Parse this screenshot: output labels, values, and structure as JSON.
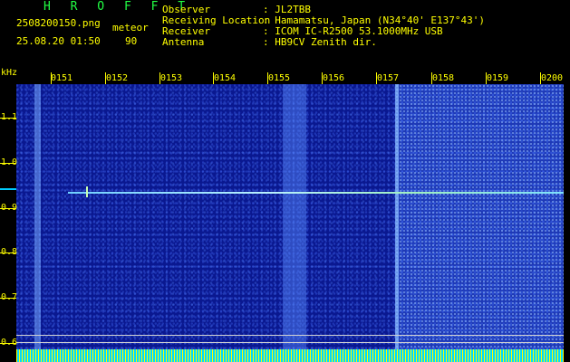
{
  "header": {
    "brand": "H R O F F T",
    "filename": "2508200150.png",
    "datetime": "25.08.20 01:50",
    "meteor_label": "meteor",
    "meteor_count": "90"
  },
  "info": [
    {
      "key": "Observer",
      "value": ": JL2TBB"
    },
    {
      "key": "Receiving Location",
      "value": ": Hamamatsu, Japan (N34°40' E137°43')"
    },
    {
      "key": "Receiver",
      "value": ": ICOM IC-R2500 53.1000MHz USB"
    },
    {
      "key": "Antenna",
      "value": ": HB9CV Zenith dir."
    }
  ],
  "axis": {
    "unit": "kHz",
    "y_ticks": [
      "1.1",
      "1.0",
      "0.9",
      "0.8",
      "0.7",
      "0.6"
    ],
    "x_ticks": [
      "0151",
      "0152",
      "0153",
      "0154",
      "0155",
      "0156",
      "0157",
      "0158",
      "0159",
      "0200"
    ]
  },
  "colors": {
    "text": "#ffff00",
    "brand": "#22ff44",
    "background": "#0a1890",
    "trace": "#b9f0ff"
  }
}
